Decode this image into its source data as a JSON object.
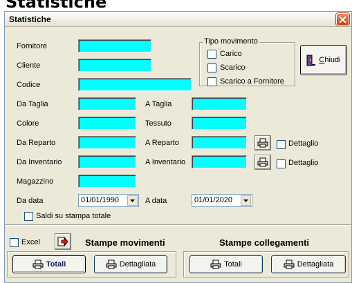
{
  "page": {
    "heading": "Statistiche"
  },
  "window": {
    "title": "Statistiche"
  },
  "labels": {
    "fornitore": "Fornitore",
    "cliente": "Cliente",
    "codice": "Codice",
    "da_taglia": "Da Taglia",
    "a_taglia": "A Taglia",
    "colore": "Colore",
    "tessuto": "Tessuto",
    "da_reparto": "Da Reparto",
    "a_reparto": "A Reparto",
    "da_inventario": "Da Inventario",
    "a_inventario": "A Inventario",
    "magazzino": "Magazzino",
    "da_data": "Da data",
    "a_data": "A data"
  },
  "fields": {
    "fornitore": "",
    "cliente": "",
    "codice": "",
    "da_taglia": "",
    "a_taglia": "",
    "colore": "",
    "tessuto": "",
    "da_reparto": "",
    "a_reparto": "",
    "da_inventario": "",
    "a_inventario": "",
    "magazzino": ""
  },
  "tipo_movimento": {
    "legend": "Tipo movimento",
    "options": [
      "Carico",
      "Scarico",
      "Scarico a Fornitore"
    ]
  },
  "buttons": {
    "chiudi_prefix": "",
    "chiudi_key": "C",
    "chiudi_rest": "hiudi",
    "totali_mov": "Totali",
    "dettagliata_mov": "Dettagliata",
    "totali_coll": "Totali",
    "dettagliata_coll": "Dettagliata"
  },
  "checkboxes": {
    "dettaglio_reparto": "Dettaglio",
    "dettaglio_inventario": "Dettaglio",
    "saldi": "Saldi su stampa totale",
    "excel": "Excel"
  },
  "dates": {
    "da_data": "01/01/1990",
    "a_data": "01/01/2020"
  },
  "sections": {
    "stampe_movimenti": "Stampe movimenti",
    "stampe_collegamenti": "Stampe collegamenti"
  },
  "colors": {
    "field_bg": "#00ffff",
    "dialog_bg": "#ece9d8",
    "close_red": "#c3400f"
  }
}
